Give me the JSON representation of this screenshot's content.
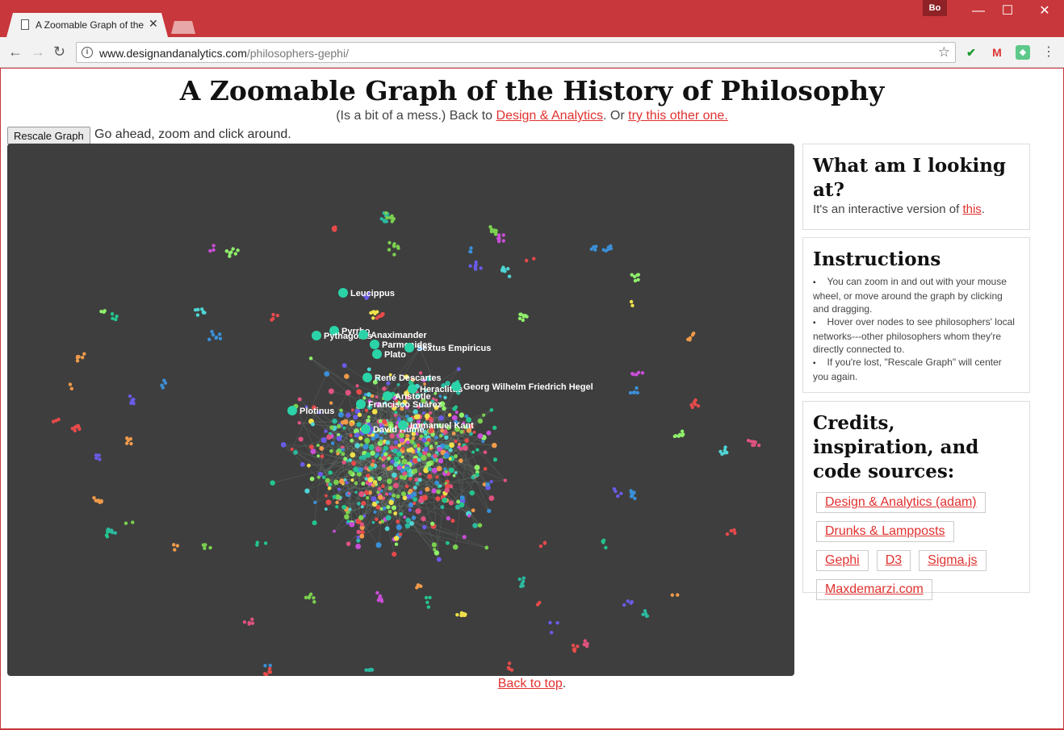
{
  "browser": {
    "tab_title": "A Zoomable Graph of the",
    "user_badge": "Bo",
    "url_host": "www.designandanalytics.com",
    "url_path": "/philosophers-gephi/",
    "window_controls": [
      "—",
      "☐",
      "✕"
    ]
  },
  "page": {
    "title": "A Zoomable Graph of the History of Philosophy",
    "subtitle_pre": "(Is a bit of a mess.) Back to ",
    "subtitle_link1": "Design & Analytics",
    "subtitle_mid": ". Or ",
    "subtitle_link2": "try this other one.",
    "rescale_button": "Rescale Graph",
    "hint": "Go ahead, zoom and click around.",
    "back_to_top": "Back to top"
  },
  "graph": {
    "background": "#3e3e3e",
    "labels": [
      "Leucippus",
      "Pyrrho",
      "Pythagoras",
      "Anaximander",
      "Parmenides",
      "Sextus Empiricus",
      "Plato",
      "René Descartes",
      "Heraclitus",
      "Georg Wilhelm Friedrich Hegel",
      "Aristotle",
      "Francisco Suárez",
      "Plotinus",
      "David Hume",
      "Immanuel Kant"
    ]
  },
  "panels": {
    "what": {
      "heading": "What am I looking at?",
      "text": "It's an interactive version of ",
      "link": "this"
    },
    "instructions": {
      "heading": "Instructions",
      "items": [
        "You can zoom in and out with your mouse wheel, or move around the graph by clicking and dragging.",
        "Hover over nodes to see philosophers' local networks---other philosophers whom they're directly connected to.",
        "If you're lost, \"Rescale Graph\" will center you again."
      ]
    },
    "credits": {
      "heading": "Credits, inspiration, and code sources:",
      "links": [
        "Design & Analytics (adam)",
        "Drunks & Lampposts",
        "Gephi",
        "D3",
        "Sigma.js",
        "Maxdemarzi.com"
      ]
    }
  },
  "colors": {
    "chrome": "#c8373b",
    "link": "#e0312f",
    "node_palette": [
      "#2bb9a0",
      "#e0537f",
      "#7ad04f",
      "#f0e04a",
      "#3b8fd8",
      "#f09a4a",
      "#c94ed6",
      "#4fd4d4",
      "#6a5be8",
      "#8ff06a",
      "#e84a4a",
      "#23c48e"
    ]
  }
}
